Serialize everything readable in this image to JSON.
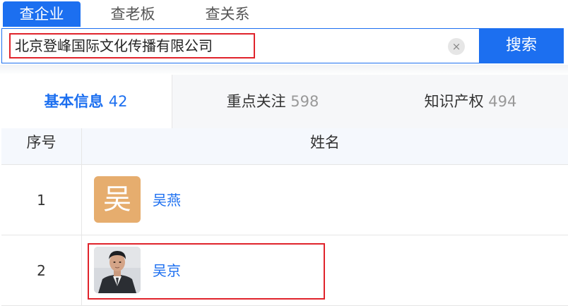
{
  "search_tabs": [
    {
      "label": "查企业",
      "active": true
    },
    {
      "label": "查老板",
      "active": false
    },
    {
      "label": "查关系",
      "active": false
    }
  ],
  "search": {
    "value": "北京登峰国际文化传播有限公司",
    "clear_icon": "×",
    "button_label": "搜索"
  },
  "category_tabs": [
    {
      "label": "基本信息",
      "count": "42",
      "active": true
    },
    {
      "label": "重点关注",
      "count": "598",
      "active": false
    },
    {
      "label": "知识产权",
      "count": "494",
      "active": false
    }
  ],
  "table": {
    "headers": {
      "seq": "序号",
      "name": "姓名"
    },
    "rows": [
      {
        "seq": "1",
        "name": "吴燕",
        "avatar_letter": "吴",
        "avatar_type": "letter"
      },
      {
        "seq": "2",
        "name": "吴京",
        "avatar_type": "photo"
      }
    ]
  },
  "colors": {
    "accent": "#1c6ff0",
    "highlight": "#e0232b",
    "avatar_letter_bg": "#e6ad6e"
  }
}
